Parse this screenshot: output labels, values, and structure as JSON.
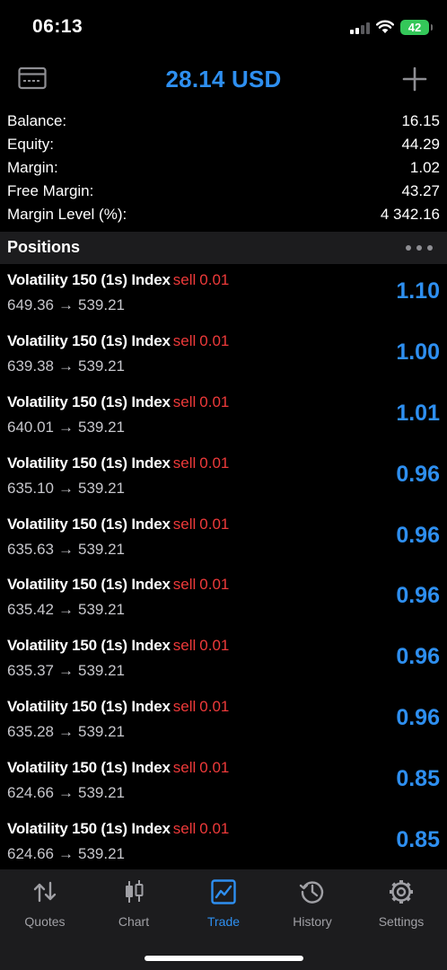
{
  "status_bar": {
    "time": "06:13",
    "battery": "42"
  },
  "header": {
    "title": "28.14 USD"
  },
  "summary": [
    {
      "label": "Balance:",
      "value": "16.15"
    },
    {
      "label": "Equity:",
      "value": "44.29"
    },
    {
      "label": "Margin:",
      "value": "1.02"
    },
    {
      "label": "Free Margin:",
      "value": "43.27"
    },
    {
      "label": "Margin Level (%):",
      "value": "4 342.16"
    }
  ],
  "positions": {
    "title": "Positions",
    "arrow": "→",
    "items": [
      {
        "symbol": "Volatility 150 (1s) Index",
        "side": "sell",
        "volume": "0.01",
        "open": "649.36",
        "current": "539.21",
        "profit": "1.10"
      },
      {
        "symbol": "Volatility 150 (1s) Index",
        "side": "sell",
        "volume": "0.01",
        "open": "639.38",
        "current": "539.21",
        "profit": "1.00"
      },
      {
        "symbol": "Volatility 150 (1s) Index",
        "side": "sell",
        "volume": "0.01",
        "open": "640.01",
        "current": "539.21",
        "profit": "1.01"
      },
      {
        "symbol": "Volatility 150 (1s) Index",
        "side": "sell",
        "volume": "0.01",
        "open": "635.10",
        "current": "539.21",
        "profit": "0.96"
      },
      {
        "symbol": "Volatility 150 (1s) Index",
        "side": "sell",
        "volume": "0.01",
        "open": "635.63",
        "current": "539.21",
        "profit": "0.96"
      },
      {
        "symbol": "Volatility 150 (1s) Index",
        "side": "sell",
        "volume": "0.01",
        "open": "635.42",
        "current": "539.21",
        "profit": "0.96"
      },
      {
        "symbol": "Volatility 150 (1s) Index",
        "side": "sell",
        "volume": "0.01",
        "open": "635.37",
        "current": "539.21",
        "profit": "0.96"
      },
      {
        "symbol": "Volatility 150 (1s) Index",
        "side": "sell",
        "volume": "0.01",
        "open": "635.28",
        "current": "539.21",
        "profit": "0.96"
      },
      {
        "symbol": "Volatility 150 (1s) Index",
        "side": "sell",
        "volume": "0.01",
        "open": "624.66",
        "current": "539.21",
        "profit": "0.85"
      },
      {
        "symbol": "Volatility 150 (1s) Index",
        "side": "sell",
        "volume": "0.01",
        "open": "624.66",
        "current": "539.21",
        "profit": "0.85"
      }
    ]
  },
  "tab_bar": {
    "active": "trade",
    "tabs": [
      {
        "id": "quotes",
        "label": "Quotes",
        "icon": "quotes-arrows-icon"
      },
      {
        "id": "chart",
        "label": "Chart",
        "icon": "candlestick-icon"
      },
      {
        "id": "trade",
        "label": "Trade",
        "icon": "trade-chart-icon"
      },
      {
        "id": "history",
        "label": "History",
        "icon": "history-clock-icon"
      },
      {
        "id": "settings",
        "label": "Settings",
        "icon": "gear-icon"
      }
    ]
  },
  "colors": {
    "accent": "#2e8ff0",
    "sell": "#ee3a3a",
    "background": "#000000",
    "panel": "#1c1c1e",
    "battery": "#34c759"
  }
}
